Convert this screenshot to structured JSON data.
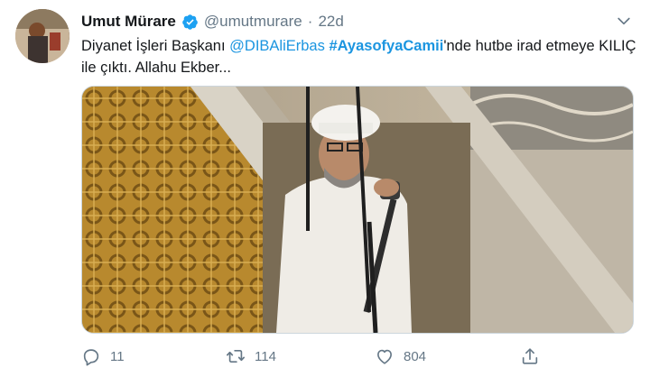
{
  "tweet": {
    "display_name": "Umut Mürare",
    "handle": "@umutmurare",
    "separator": "·",
    "time": "22d",
    "text": {
      "part1": "Diyanet İşleri Başkanı ",
      "mention": "@DIBAliErbas",
      "part2": " ",
      "hashtag": "#AyasofyaCamii",
      "part3": "'nde hutbe irad etmeye KILIÇ ile çıktı. Allahu Ekber..."
    },
    "actions": {
      "reply_count": "11",
      "retweet_count": "114",
      "like_count": "804"
    }
  },
  "icons": {
    "verified": "verified-badge-icon",
    "more": "chevron-down-icon",
    "reply": "reply-icon",
    "retweet": "retweet-icon",
    "like": "heart-icon",
    "share": "share-icon"
  },
  "colors": {
    "link": "#1b95e0",
    "secondary_text": "#657786",
    "primary_text": "#14171a"
  }
}
